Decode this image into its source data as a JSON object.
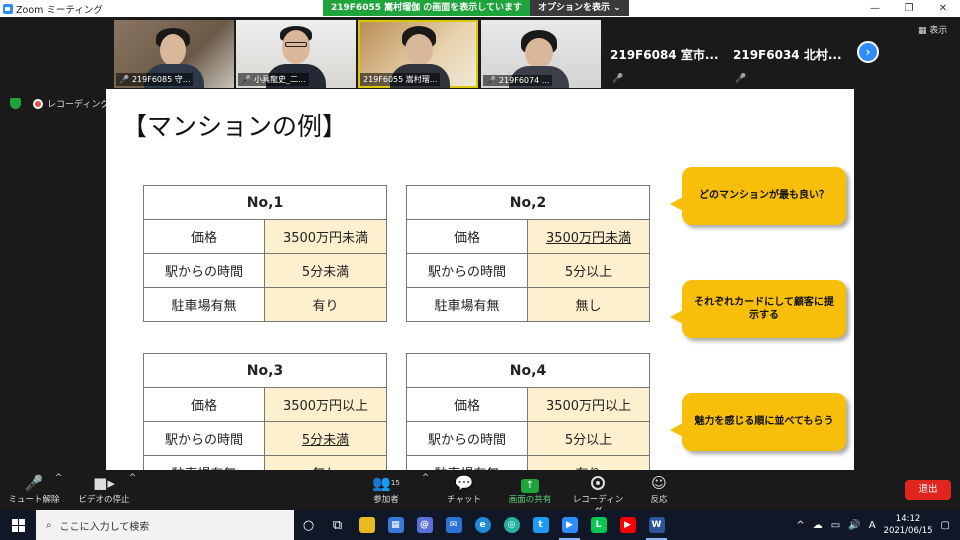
{
  "window": {
    "app_title": "Zoom ミーティング",
    "share_banner": "219F6055 嵩村瑠伽 の画面を表示しています",
    "options_label": "オプションを表示",
    "minimize": "—",
    "restore": "❐",
    "close": "✕"
  },
  "gallery": {
    "participants": [
      {
        "label": "219F6085 守..."
      },
      {
        "label": "小具龍史_二..."
      },
      {
        "label": "219F6055 嵩村瑠..."
      },
      {
        "label": "219F6074 ..."
      }
    ],
    "name_tiles": [
      {
        "name": "219F6084 室市..."
      },
      {
        "name": "219F6034 北村..."
      }
    ],
    "view_label": "表示"
  },
  "recording_label": "レコーディング中",
  "slide": {
    "title": "【マンションの例】",
    "cards": [
      {
        "header": "No,1",
        "rows": [
          {
            "key": "価格",
            "value": "3500万円未満"
          },
          {
            "key": "駅からの時間",
            "value": "5分未満"
          },
          {
            "key": "駐車場有無",
            "value": "有り"
          }
        ]
      },
      {
        "header": "No,2",
        "rows": [
          {
            "key": "価格",
            "value": "3500万円未満"
          },
          {
            "key": "駅からの時間",
            "value": "5分以上"
          },
          {
            "key": "駐車場有無",
            "value": "無し"
          }
        ]
      },
      {
        "header": "No,3",
        "rows": [
          {
            "key": "価格",
            "value": "3500万円以上"
          },
          {
            "key": "駅からの時間",
            "value": "5分未満"
          },
          {
            "key": "駐車場有無",
            "value": "無し"
          }
        ]
      },
      {
        "header": "No,4",
        "rows": [
          {
            "key": "価格",
            "value": "3500万円以上"
          },
          {
            "key": "駅からの時間",
            "value": "5分以上"
          },
          {
            "key": "駐車場有無",
            "value": "有り"
          }
        ]
      }
    ],
    "bubbles": [
      "どのマンションが最も良い？",
      "それぞれカードにして顧客に提示する",
      "魅力を感じる順に並べてもらう"
    ]
  },
  "toolbar": {
    "mute": "ミュート解除",
    "video": "ビデオの停止",
    "participants": "参加者",
    "participants_count": "15",
    "chat": "チャット",
    "share": "画面の共有",
    "record": "レコーディング",
    "reactions": "反応",
    "leave": "退出"
  },
  "taskbar": {
    "search_placeholder": "ここに入力して検索",
    "time": "14:12",
    "date": "2021/06/15",
    "ime": "A"
  },
  "colors": {
    "accent": "#2d8cff",
    "share_green": "#1fa33b",
    "bubble": "#f7be0a",
    "cell_fill": "#fdf0cf",
    "leave_red": "#e0251f"
  }
}
